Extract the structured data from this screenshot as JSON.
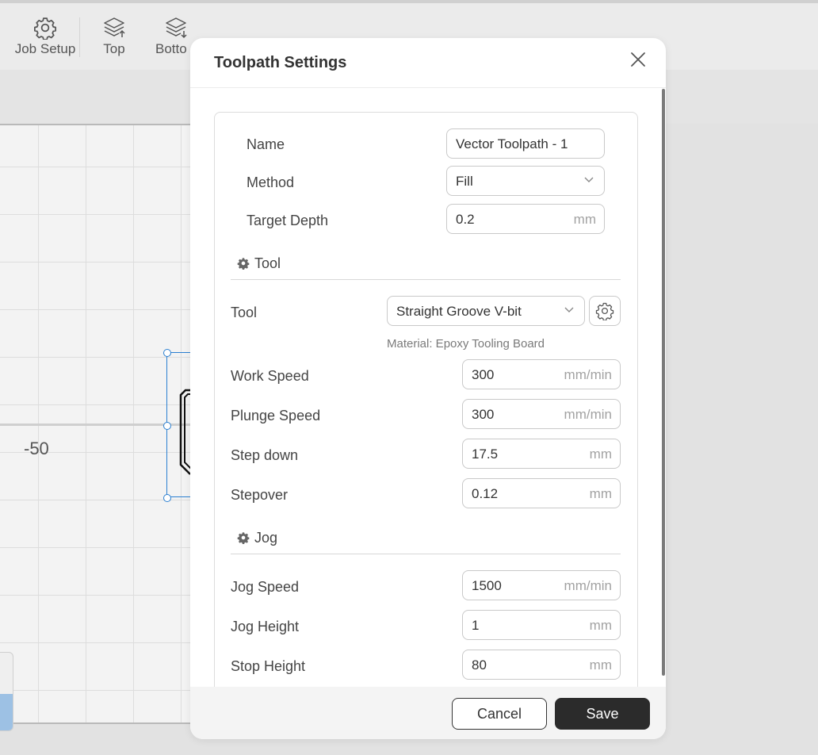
{
  "toolbar": {
    "job_setup": "Job Setup",
    "top": "Top",
    "bottom": "Botto"
  },
  "canvas": {
    "axis_label": "-50"
  },
  "dialog": {
    "title": "Toolpath Settings",
    "name_label": "Name",
    "name_value": "Vector Toolpath - 1",
    "method_label": "Method",
    "method_value": "Fill",
    "target_depth_label": "Target Depth",
    "target_depth_value": "0.2",
    "target_depth_unit": "mm",
    "tool_section": "Tool",
    "tool_label": "Tool",
    "tool_value": "Straight Groove V-bit",
    "material": "Material: Epoxy Tooling Board",
    "work_speed_label": "Work Speed",
    "work_speed_value": "300",
    "work_speed_unit": "mm/min",
    "plunge_speed_label": "Plunge Speed",
    "plunge_speed_value": "300",
    "plunge_speed_unit": "mm/min",
    "step_down_label": "Step down",
    "step_down_value": "17.5",
    "step_down_unit": "mm",
    "stepover_label": "Stepover",
    "stepover_value": "0.12",
    "stepover_unit": "mm",
    "jog_section": "Jog",
    "jog_speed_label": "Jog Speed",
    "jog_speed_value": "1500",
    "jog_speed_unit": "mm/min",
    "jog_height_label": "Jog Height",
    "jog_height_value": "1",
    "jog_height_unit": "mm",
    "stop_height_label": "Stop Height",
    "stop_height_value": "80",
    "stop_height_unit": "mm",
    "cancel": "Cancel",
    "save": "Save"
  }
}
